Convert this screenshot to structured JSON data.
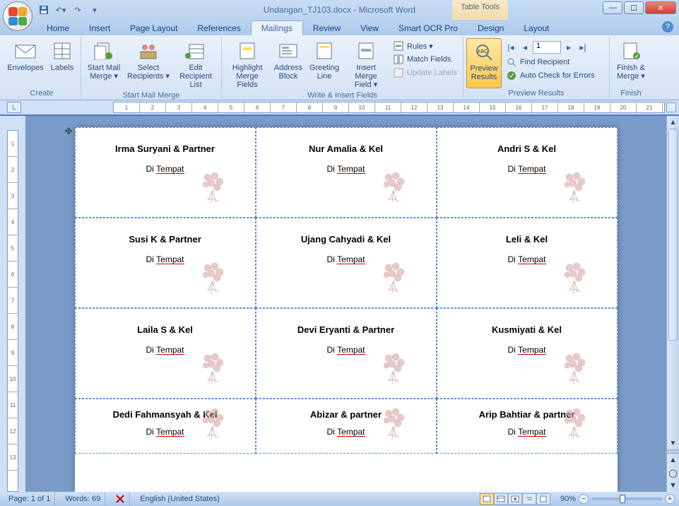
{
  "title": "Undangan_TJ103.docx - Microsoft Word",
  "table_tools": "Table Tools",
  "tabs": [
    "Home",
    "Insert",
    "Page Layout",
    "References",
    "Mailings",
    "Review",
    "View",
    "Smart OCR Pro",
    "Design",
    "Layout"
  ],
  "active_tab": 4,
  "ribbon": {
    "create": {
      "label": "Create",
      "envelopes": "Envelopes",
      "labels": "Labels"
    },
    "start": {
      "label": "Start Mail Merge",
      "start_mm": "Start Mail\nMerge ▾",
      "select_recip": "Select\nRecipients ▾",
      "edit_recip": "Edit\nRecipient List"
    },
    "write": {
      "label": "Write & Insert Fields",
      "highlight": "Highlight\nMerge Fields",
      "address": "Address\nBlock",
      "greeting": "Greeting\nLine",
      "insert_mf": "Insert Merge\nField ▾",
      "rules": "Rules ▾",
      "match": "Match Fields",
      "update": "Update Labels"
    },
    "preview": {
      "label": "Preview Results",
      "preview_btn": "Preview\nResults",
      "record": "1",
      "find": "Find Recipient",
      "auto_check": "Auto Check for Errors"
    },
    "finish": {
      "label": "Finish",
      "finish_btn": "Finish &\nMerge ▾"
    }
  },
  "cells": [
    {
      "name": "Irma Suryani & Partner",
      "sub": "Di Tempat"
    },
    {
      "name": "Nur Amalia & Kel",
      "sub": "Di Tempat"
    },
    {
      "name": "Andri S & Kel",
      "sub": "Di Tempat"
    },
    {
      "name": "Susi K & Partner",
      "sub": "Di Tempat"
    },
    {
      "name": "Ujang Cahyadi & Kel",
      "sub": "Di Tempat"
    },
    {
      "name": "Leli & Kel",
      "sub": "Di Tempat"
    },
    {
      "name": "Laila S & Kel",
      "sub": "Di Tempat"
    },
    {
      "name": "Devi Eryanti & Partner",
      "sub": "Di Tempat"
    },
    {
      "name": "Kusmiyati & Kel",
      "sub": "Di Tempat"
    },
    {
      "name": "Dedi Fahmansyah & Kel",
      "sub": "Di Tempat"
    },
    {
      "name": "Abizar & partner",
      "sub": "Di Tempat"
    },
    {
      "name": "Arip Bahtiar & partner",
      "sub": "Di Tempat"
    }
  ],
  "status": {
    "page": "Page: 1 of 1",
    "words": "Words: 69",
    "lang": "English (United States)",
    "zoom": "90%"
  }
}
